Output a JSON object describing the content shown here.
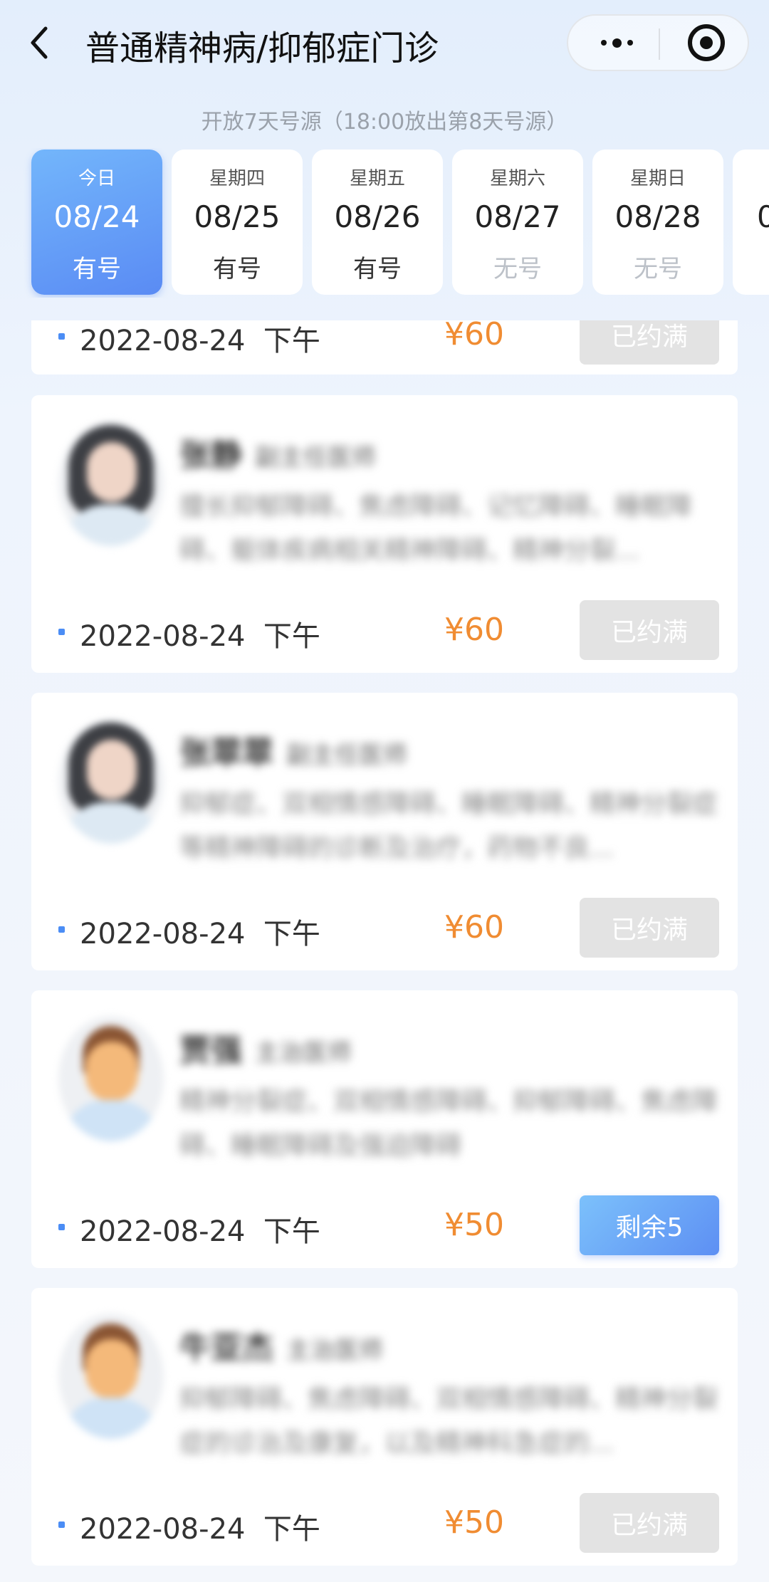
{
  "nav": {
    "title": "普通精神病/抑郁症门诊"
  },
  "notice": "开放7天号源（18:00放出第8天号源）",
  "dates": [
    {
      "weekday": "今日",
      "date": "08/24",
      "status": "有号"
    },
    {
      "weekday": "星期四",
      "date": "08/25",
      "status": "有号"
    },
    {
      "weekday": "星期五",
      "date": "08/26",
      "status": "有号"
    },
    {
      "weekday": "星期六",
      "date": "08/27",
      "status": "无号"
    },
    {
      "weekday": "星期日",
      "date": "08/28",
      "status": "无号"
    },
    {
      "weekday": "",
      "date": "0",
      "status": ""
    }
  ],
  "partial_slot": {
    "date": "2022-08-24",
    "period": "下午",
    "price": "¥60",
    "button": "已约满"
  },
  "doctors": [
    {
      "name": "张静",
      "title": "副主任医师",
      "specialty": "擅长抑郁障碍、焦虑障碍、记忆障碍、睡眠障碍、躯体疾病相关精神障碍、精神分裂...",
      "slot": {
        "date": "2022-08-24",
        "period": "下午",
        "price": "¥60",
        "button": "已约满"
      }
    },
    {
      "name": "张翠翠",
      "title": "副主任医师",
      "specialty": "抑郁症、双相情感障碍、睡眠障碍、精神分裂症等精神障碍的诊断及治疗，药物不良...",
      "slot": {
        "date": "2022-08-24",
        "period": "下午",
        "price": "¥60",
        "button": "已约满"
      }
    },
    {
      "name": "贾强",
      "title": "主治医师",
      "specialty": "精神分裂症、双相情感障碍、抑郁障碍、焦虑障碍、睡眠障碍及强迫障碍",
      "slot": {
        "date": "2022-08-24",
        "period": "下午",
        "price": "¥50",
        "button": "剩余5"
      }
    },
    {
      "name": "牛亚杰",
      "title": "主治医师",
      "specialty": "抑郁障碍、焦虑障碍、双相情感障碍、精神分裂症的诊治及康复，以及精神科急症的...",
      "slot": {
        "date": "2022-08-24",
        "period": "下午",
        "price": "¥50",
        "button": "已约满"
      }
    }
  ],
  "colors": {
    "accent": "#5a8bf4",
    "price": "#f08c32",
    "full_button": "#e3e3e3"
  }
}
